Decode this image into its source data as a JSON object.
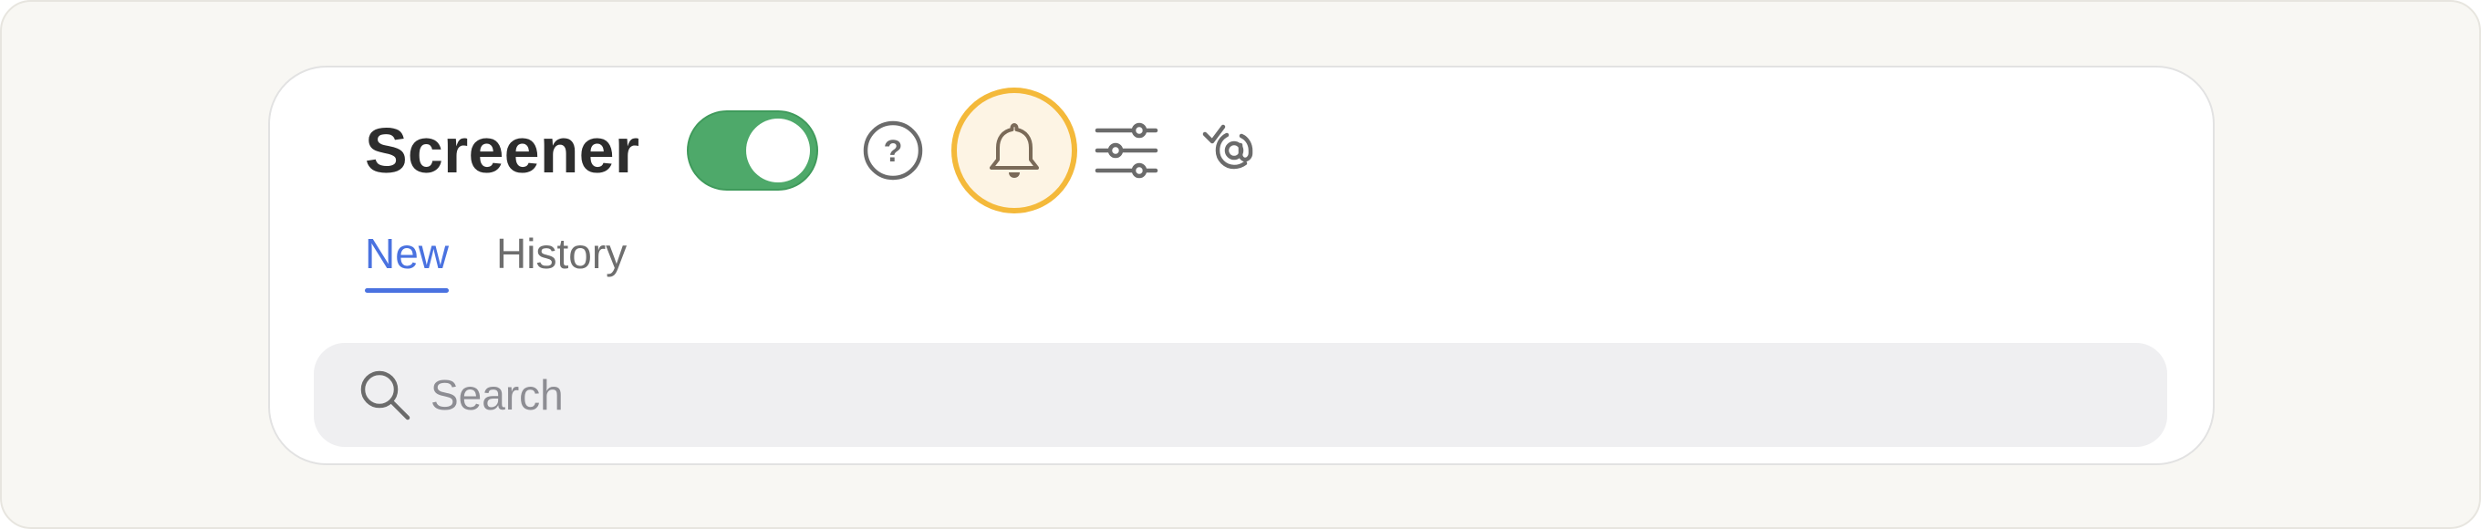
{
  "header": {
    "title": "Screener",
    "toggle": {
      "state": "on",
      "color": "#4ea96a"
    },
    "icons": [
      {
        "name": "help-circle-icon",
        "glyph": "?"
      },
      {
        "name": "bell-icon",
        "highlighted": true,
        "highlight_color": "#f4b93a"
      },
      {
        "name": "sliders-icon"
      },
      {
        "name": "mention-check-icon"
      }
    ]
  },
  "tabs": [
    {
      "label": "New",
      "active": true
    },
    {
      "label": "History",
      "active": false
    }
  ],
  "search": {
    "placeholder": "Search",
    "value": ""
  },
  "colors": {
    "accent": "#4a72e0",
    "toggle_on": "#4ea96a",
    "highlight": "#f4b93a"
  }
}
